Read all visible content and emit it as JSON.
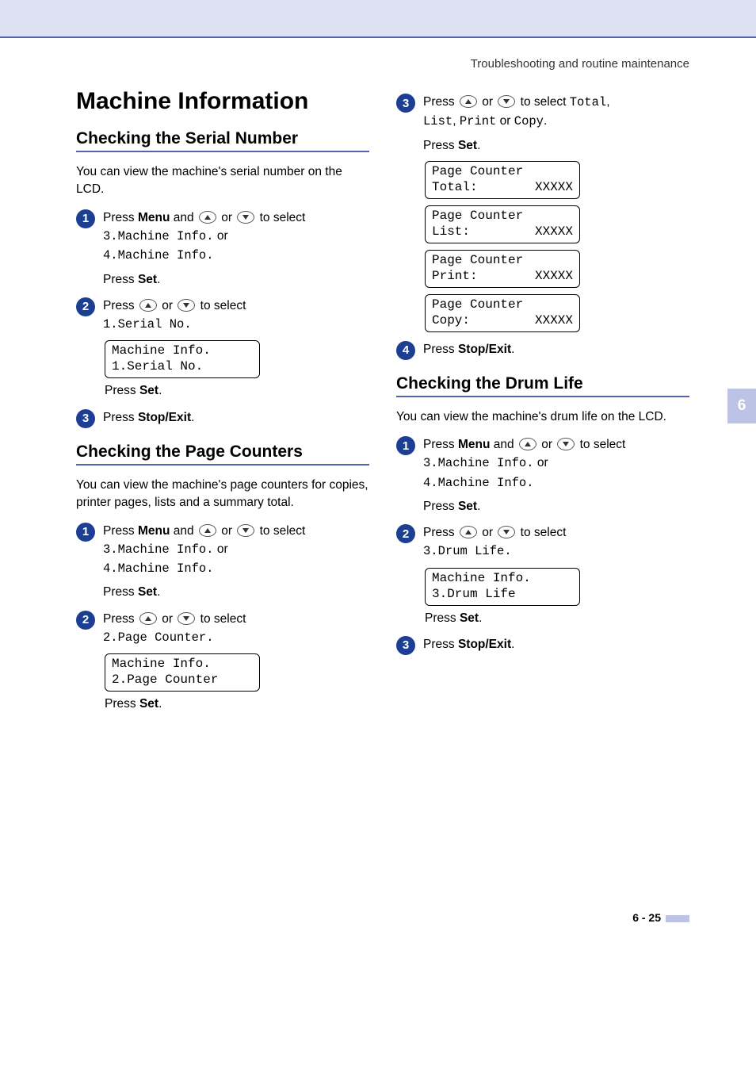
{
  "header": {
    "breadcrumb": "Troubleshooting and routine maintenance"
  },
  "title": "Machine Information",
  "side_tab": "6",
  "page_num": "6 - 25",
  "shared": {
    "press": "Press ",
    "menu": "Menu",
    "and": " and ",
    "or_word": " or ",
    "or_plain": " or ",
    "to_select": " to select",
    "set": "Set",
    "stop_exit": "Stop/Exit",
    "dot": "."
  },
  "serial": {
    "heading": "Checking the Serial Number",
    "intro": "You can view the machine's serial number on the LCD.",
    "menu3": "3.Machine Info.",
    "menu4": "4.Machine Info.",
    "select1": "1.Serial No.",
    "lcd_l1": "Machine Info.",
    "lcd_l2": "1.Serial No."
  },
  "counters": {
    "heading": "Checking the Page Counters",
    "intro": "You can view the machine's page counters for copies, printer pages, lists and a summary total.",
    "menu3": "3.Machine Info.",
    "menu4": "4.Machine Info.",
    "select2": "2.Page Counter",
    "select2dot": "2.Page Counter.",
    "lcd_l1": "Machine Info.",
    "lcd_l2": "2.Page Counter",
    "choices_total": "Total",
    "choices_list": "List",
    "choices_print": "Print",
    "choices_copy": "Copy",
    "lcds": [
      {
        "l1": "Page Counter",
        "l2a": "Total:",
        "l2b": "XXXXX"
      },
      {
        "l1": "Page Counter",
        "l2a": "List:",
        "l2b": "XXXXX"
      },
      {
        "l1": "Page Counter",
        "l2a": "Print:",
        "l2b": "XXXXX"
      },
      {
        "l1": "Page Counter",
        "l2a": "Copy:",
        "l2b": "XXXXX"
      }
    ]
  },
  "drum": {
    "heading": "Checking the Drum Life",
    "intro": "You can view the machine's drum life on the LCD.",
    "menu3": "3.Machine Info.",
    "menu4": "4.Machine Info.",
    "select3": "3.Drum Life",
    "select3dot": "3.Drum Life.",
    "lcd_l1": "Machine Info.",
    "lcd_l2": "3.Drum Life"
  }
}
